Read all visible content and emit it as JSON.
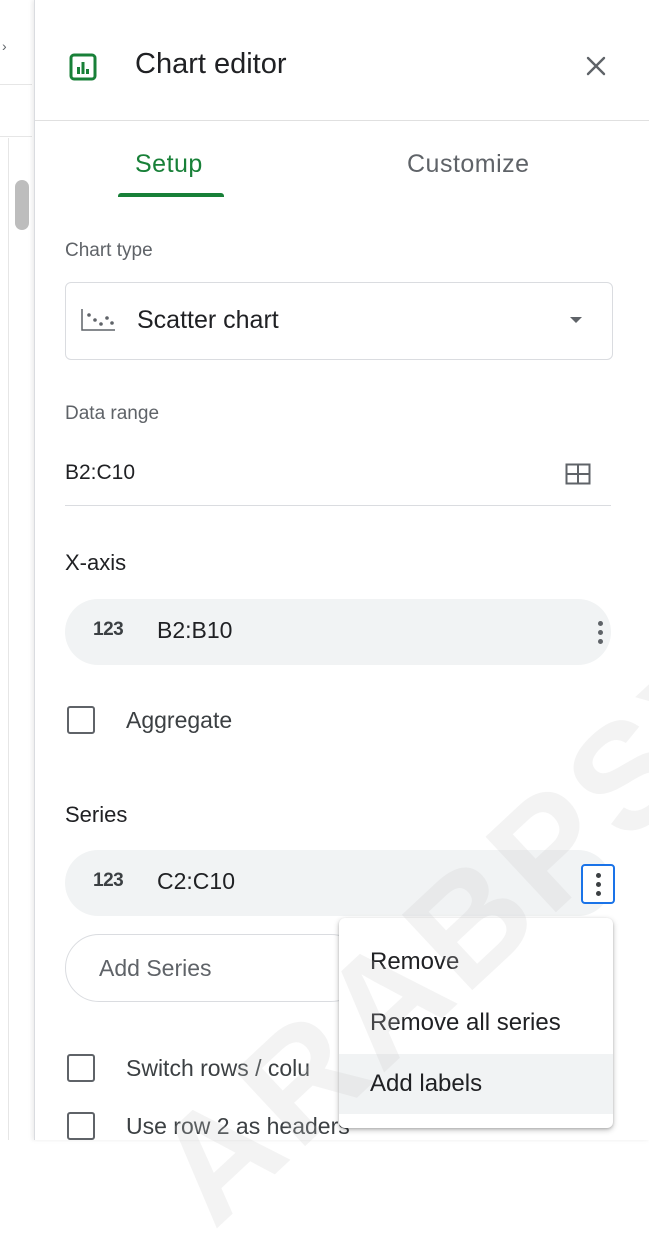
{
  "panel": {
    "title": "Chart editor",
    "icon": "chart-editor-icon",
    "close_icon": "close-icon"
  },
  "tabs": [
    {
      "label": "Setup",
      "active": true
    },
    {
      "label": "Customize",
      "active": false
    }
  ],
  "chart_type": {
    "label": "Chart type",
    "value": "Scatter chart",
    "icon": "scatter-chart-icon"
  },
  "data_range": {
    "label": "Data range",
    "value": "B2:C10",
    "icon": "grid-select-icon"
  },
  "x_axis": {
    "label": "X-axis",
    "range": "B2:B10",
    "type_icon": "123"
  },
  "aggregate": {
    "label": "Aggregate",
    "checked": false
  },
  "series": {
    "label": "Series",
    "range": "C2:C10",
    "type_icon": "123",
    "add_label": "Add Series"
  },
  "options": [
    {
      "label": "Switch rows / colu",
      "checked": false
    },
    {
      "label": "Use row 2 as headers",
      "checked": false
    }
  ],
  "context_menu": {
    "items": [
      {
        "label": "Remove"
      },
      {
        "label": "Remove all series"
      },
      {
        "label": "Add labels",
        "highlighted": true
      }
    ]
  },
  "watermark": "ARABPSYCHO",
  "colors": {
    "accent": "#188038",
    "focus": "#1a73e8",
    "pill_bg": "#f1f3f4"
  }
}
